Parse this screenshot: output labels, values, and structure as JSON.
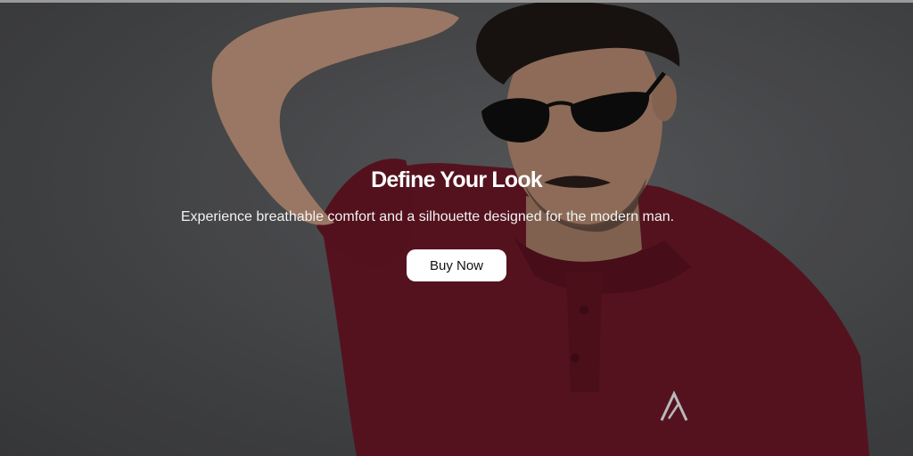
{
  "hero": {
    "headline": "Define Your Look",
    "subheadline": "Experience breathable comfort and a silhouette designed for the modern man.",
    "cta_label": "Buy Now",
    "shirt_color": "#5c1422",
    "background_color": "#4a4b4d"
  }
}
